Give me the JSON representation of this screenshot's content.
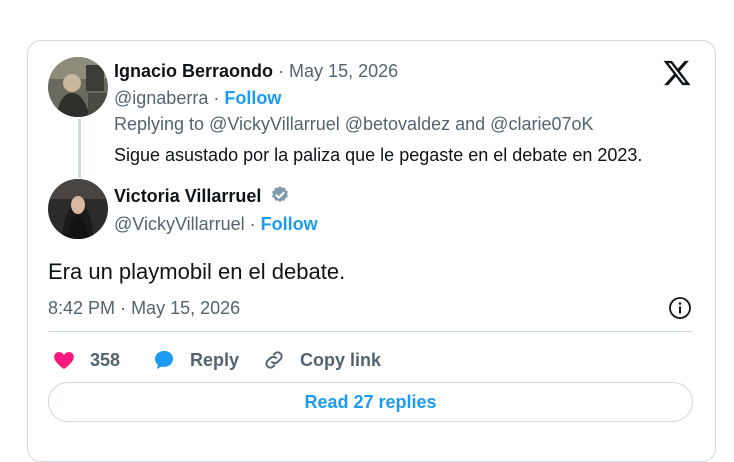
{
  "card": {
    "logo_icon": "x-logo-icon",
    "parent": {
      "name": "Ignacio Berraondo",
      "date": "May 15, 2026",
      "handle": "@ignaberra",
      "follow_label": "Follow",
      "replying_prefix": "Replying to",
      "mentions": [
        "@VickyVillarruel",
        "@betovaldez",
        "and",
        "@clarie07oK"
      ],
      "text": "Sigue asustado por la paliza que le pegaste en el debate en 2023."
    },
    "main": {
      "name": "Victoria Villarruel",
      "verified_icon": "verified-badge-icon",
      "handle": "@VickyVillarruel",
      "follow_label": "Follow",
      "text": "Era un playmobil en el debate.",
      "time": "8:42 PM",
      "date": "May 15, 2026"
    },
    "actions": {
      "like_count": "358",
      "reply_label": "Reply",
      "copy_label": "Copy link"
    },
    "read_replies_label": "Read 27 replies"
  },
  "colors": {
    "accent": "#1d9bf0",
    "like": "#f91880",
    "muted": "#536471",
    "border": "#cfd9de"
  }
}
